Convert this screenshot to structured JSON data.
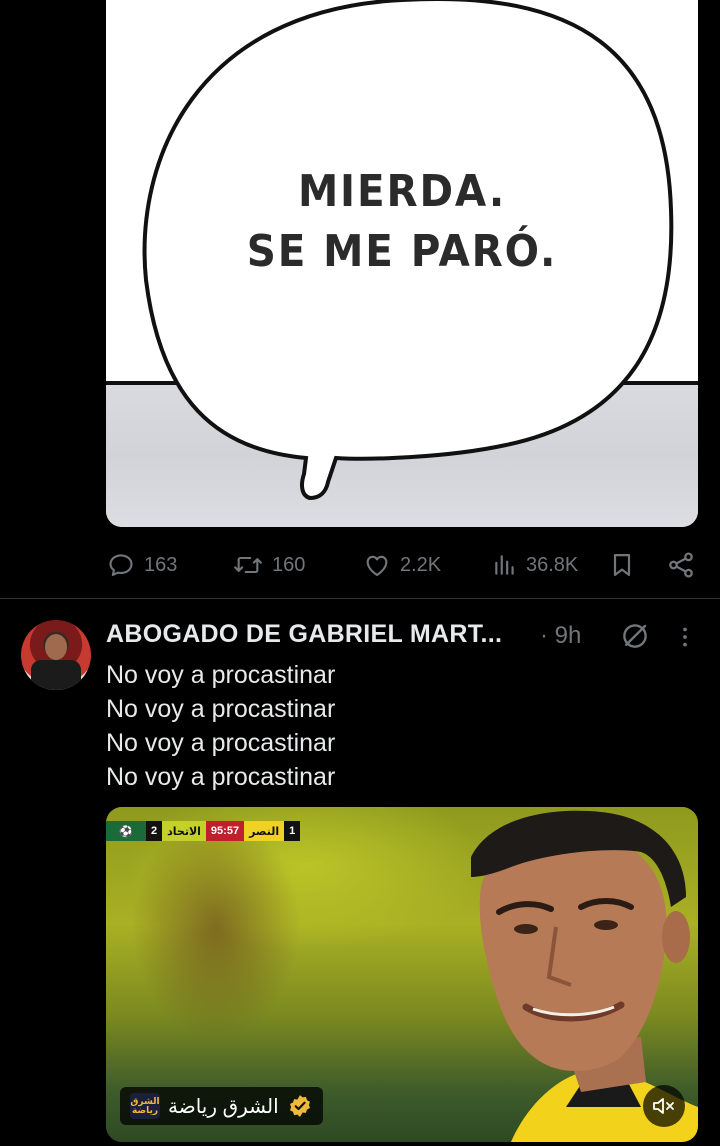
{
  "tweet1": {
    "image_text_line1": "MIERDA.",
    "image_text_line2": "SE ME PARÓ.",
    "actions": {
      "replies": "163",
      "reposts": "160",
      "likes": "2.2K",
      "views": "36.8K"
    }
  },
  "tweet2": {
    "author_name": "ABOGADO DE GABRIEL MART...",
    "time": "· 9h",
    "text_lines": [
      "No voy a procastinar",
      "No voy a procastinar",
      "No voy a procastinar",
      "No voy a procastinar"
    ],
    "video": {
      "score_home_goals": "1",
      "score_home_team": "النصر",
      "score_clock": "95:57",
      "score_away_team": "الاتحاد",
      "score_away_goals": "2",
      "channel_name": "الشرق رياضة",
      "channel_logo_text": "الشرق رياضة",
      "verified_color": "#f0b93b"
    }
  },
  "colors": {
    "background": "#000000",
    "text_primary": "#e7e9ea",
    "text_secondary": "#71767b",
    "divider": "#2f3336"
  }
}
